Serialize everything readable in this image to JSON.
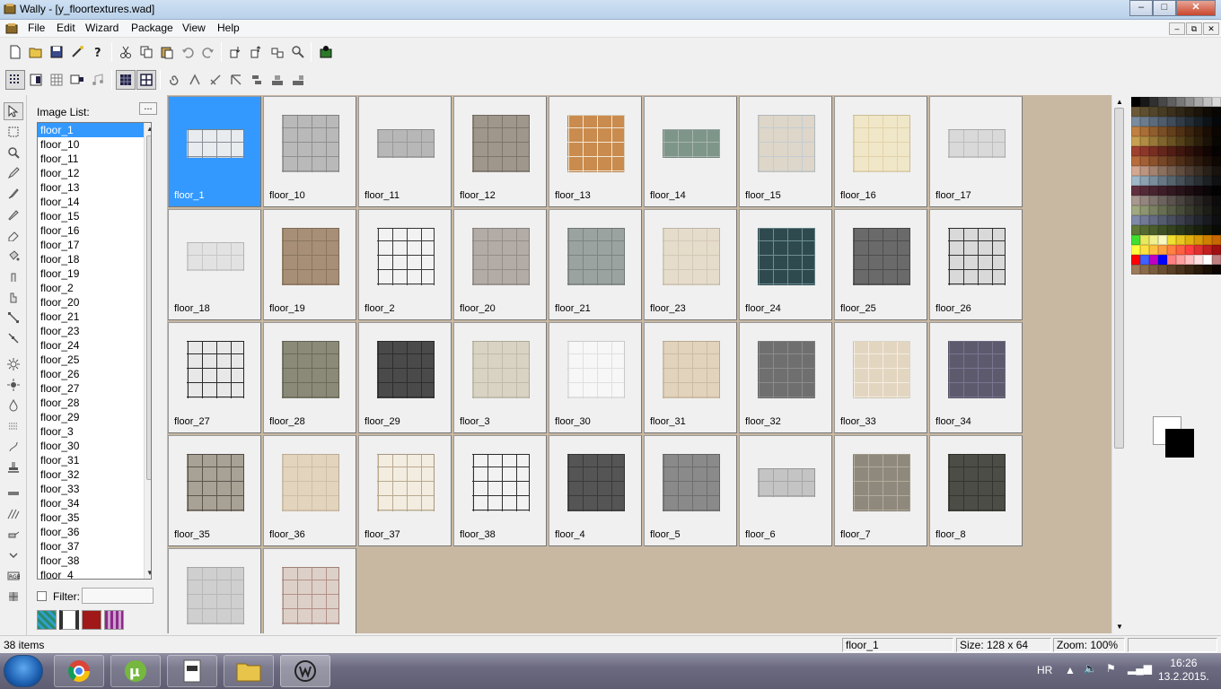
{
  "window": {
    "title": "Wally - [y_floortextures.wad]"
  },
  "menu": [
    "File",
    "Edit",
    "Wizard",
    "Package",
    "View",
    "Help"
  ],
  "imagelist": {
    "label": "Image List:",
    "more": "...",
    "items": [
      "floor_1",
      "floor_10",
      "floor_11",
      "floor_12",
      "floor_13",
      "floor_14",
      "floor_15",
      "floor_16",
      "floor_17",
      "floor_18",
      "floor_19",
      "floor_2",
      "floor_20",
      "floor_21",
      "floor_23",
      "floor_24",
      "floor_25",
      "floor_26",
      "floor_27",
      "floor_28",
      "floor_29",
      "floor_3",
      "floor_30",
      "floor_31",
      "floor_32",
      "floor_33",
      "floor_34",
      "floor_35",
      "floor_36",
      "floor_37",
      "floor_38",
      "floor_4"
    ],
    "selected": "floor_1",
    "filter_label": "Filter:",
    "filter_value": ""
  },
  "thumbnails": [
    {
      "name": "floor_1",
      "color": "#e8ecef",
      "accent": "#8a9099",
      "wide": true
    },
    {
      "name": "floor_10",
      "color": "#b9b9b9",
      "accent": "#8f8f8f"
    },
    {
      "name": "floor_11",
      "color": "#b7b7b7",
      "accent": "#9a9a9a",
      "wide": true
    },
    {
      "name": "floor_12",
      "color": "#9f968c",
      "accent": "#7d746b"
    },
    {
      "name": "floor_13",
      "color": "#c98b4e",
      "accent": "#f2e6d4"
    },
    {
      "name": "floor_14",
      "color": "#7e958a",
      "accent": "#a9b6ad",
      "wide": true
    },
    {
      "name": "floor_15",
      "color": "#ddd6c9",
      "accent": "#c4ccd2"
    },
    {
      "name": "floor_16",
      "color": "#f0e6c8",
      "accent": "#e2d3a8"
    },
    {
      "name": "floor_17",
      "color": "#d9d9d9",
      "accent": "#bdbdbd",
      "wide": true
    },
    {
      "name": "floor_18",
      "color": "#e2e2e2",
      "accent": "#c8c8c8",
      "wide": true
    },
    {
      "name": "floor_19",
      "color": "#a68f76",
      "accent": "#8c7660"
    },
    {
      "name": "floor_2",
      "color": "#f2f2f2",
      "accent": "#3a3a3a"
    },
    {
      "name": "floor_20",
      "color": "#b3aba6",
      "accent": "#958d88"
    },
    {
      "name": "floor_21",
      "color": "#9aa3a0",
      "accent": "#7c8582"
    },
    {
      "name": "floor_23",
      "color": "#e6dccb",
      "accent": "#d4c9b6"
    },
    {
      "name": "floor_24",
      "color": "#2f4a4f",
      "accent": "#6e8f93"
    },
    {
      "name": "floor_25",
      "color": "#6a6a6a",
      "accent": "#4d4d4d"
    },
    {
      "name": "floor_26",
      "color": "#d9d9d9",
      "accent": "#333333"
    },
    {
      "name": "floor_27",
      "color": "#e8e8e8",
      "accent": "#2a2a2a"
    },
    {
      "name": "floor_28",
      "color": "#8b8a78",
      "accent": "#6c6b5b"
    },
    {
      "name": "floor_29",
      "color": "#4a4a4a",
      "accent": "#2e2e2e"
    },
    {
      "name": "floor_3",
      "color": "#d9d3c4",
      "accent": "#c2bba9"
    },
    {
      "name": "floor_30",
      "color": "#f7f7f7",
      "accent": "#e0e0e0"
    },
    {
      "name": "floor_31",
      "color": "#e2d3bd",
      "accent": "#cdbca3"
    },
    {
      "name": "floor_32",
      "color": "#6f6f6f",
      "accent": "#8b8b8b"
    },
    {
      "name": "floor_33",
      "color": "#e3d6c1",
      "accent": "#f4ede0"
    },
    {
      "name": "floor_34",
      "color": "#5e5a6e",
      "accent": "#7a7590"
    },
    {
      "name": "floor_35",
      "color": "#a7a196",
      "accent": "#5b554c"
    },
    {
      "name": "floor_36",
      "color": "#e3d4bd",
      "accent": "#cfbfa6"
    },
    {
      "name": "floor_37",
      "color": "#f3ece0",
      "accent": "#b9a98e"
    },
    {
      "name": "floor_38",
      "color": "#f2f2f2",
      "accent": "#2f2f2f"
    },
    {
      "name": "floor_4",
      "color": "#555555",
      "accent": "#3a3a3a"
    },
    {
      "name": "floor_5",
      "color": "#8a8a8a",
      "accent": "#6e6e6e"
    },
    {
      "name": "floor_6",
      "color": "#c4c4c4",
      "accent": "#a6a6a6",
      "wide": true
    },
    {
      "name": "floor_7",
      "color": "#8f887c",
      "accent": "#b3ab9c"
    },
    {
      "name": "floor_8",
      "color": "#4d4d47",
      "accent": "#35352f"
    },
    {
      "name": "",
      "color": "#cfcfcf",
      "accent": "#b8b8b8"
    },
    {
      "name": "",
      "color": "#ddd0c8",
      "accent": "#b48f86"
    }
  ],
  "palette_colors": [
    "#000000",
    "#181818",
    "#303030",
    "#484848",
    "#606060",
    "#787878",
    "#909090",
    "#a8a8a8",
    "#c0c0c0",
    "#d8d8d8",
    "#6b5a38",
    "#5e4f30",
    "#52452a",
    "#473b23",
    "#3b301c",
    "#302716",
    "#251d10",
    "#1a140a",
    "#100c05",
    "#080602",
    "#7a8ca0",
    "#6b7c8e",
    "#5c6b7c",
    "#4e5c6b",
    "#404c5a",
    "#323c48",
    "#252d37",
    "#182027",
    "#0d1318",
    "#05080a",
    "#c08040",
    "#a86e36",
    "#905d2d",
    "#7a4e25",
    "#643f1c",
    "#503115",
    "#3c240e",
    "#2a1808",
    "#1a0e04",
    "#0c0602",
    "#c8a050",
    "#b08c44",
    "#987838",
    "#80642d",
    "#6a5223",
    "#54411a",
    "#403012",
    "#2c200b",
    "#1a1206",
    "#0a0602",
    "#a04030",
    "#8c3729",
    "#782e22",
    "#64261b",
    "#511e15",
    "#40170f",
    "#2f100a",
    "#200a06",
    "#120503",
    "#060201",
    "#b86c3c",
    "#a25f35",
    "#8c522d",
    "#774626",
    "#623a1f",
    "#4f2e18",
    "#3c2312",
    "#2b180c",
    "#1c0f07",
    "#0e0703",
    "#d4a890",
    "#bb9580",
    "#a3826f",
    "#8c705f",
    "#765e4f",
    "#614d40",
    "#4d3d32",
    "#3a2e25",
    "#292019",
    "#18130e",
    "#a0b8c8",
    "#8ca2b1",
    "#798d9a",
    "#677884",
    "#56646e",
    "#465159",
    "#373f45",
    "#292f33",
    "#1c2022",
    "#0f1112",
    "#603040",
    "#542a38",
    "#482430",
    "#3d1e28",
    "#321820",
    "#271319",
    "#1d0e12",
    "#13090c",
    "#0a0506",
    "#030202",
    "#a89890",
    "#94867f",
    "#80746e",
    "#6d635e",
    "#5b524e",
    "#49423f",
    "#383330",
    "#282423",
    "#1a1716",
    "#0d0b0b",
    "#a0a880",
    "#8d9471",
    "#7a8162",
    "#686e54",
    "#575c46",
    "#474b39",
    "#383b2d",
    "#2a2c21",
    "#1d1e17",
    "#0f100c",
    "#808aa8",
    "#717a95",
    "#636a82",
    "#565c70",
    "#494e5f",
    "#3c404e",
    "#30333e",
    "#24262f",
    "#191b21",
    "#0e0f13",
    "#607838",
    "#556a31",
    "#4a5d2b",
    "#3f5025",
    "#35431f",
    "#2b3719",
    "#222b13",
    "#19200e",
    "#111609",
    "#090b05",
    "#40e030",
    "#e8e860",
    "#f0f090",
    "#f8f8c0",
    "#f0e030",
    "#e8c820",
    "#e0b010",
    "#d89808",
    "#d08000",
    "#c86800",
    "#ffff40",
    "#ffe040",
    "#ffc040",
    "#ffa040",
    "#ff8040",
    "#ff6040",
    "#ff4040",
    "#e03030",
    "#c02020",
    "#a01010",
    "#ff0000",
    "#4060ff",
    "#c000c0",
    "#0000ff",
    "#ff8080",
    "#ffa0a0",
    "#ffc0c0",
    "#ffe0e0",
    "#ffffff",
    "#c08080",
    "#9c7a5a",
    "#8a6a4a",
    "#7a5c3e",
    "#6a4e32",
    "#5a4026",
    "#4a331c",
    "#3a2612",
    "#2a1a0a",
    "#1a0f04",
    "#0a0501"
  ],
  "status": {
    "items": "38 items",
    "name": "floor_1",
    "size": "Size: 128 x 64",
    "zoom": "Zoom: 100%"
  },
  "taskbar": {
    "lang": "HR",
    "time": "16:26",
    "date": "13.2.2015."
  }
}
